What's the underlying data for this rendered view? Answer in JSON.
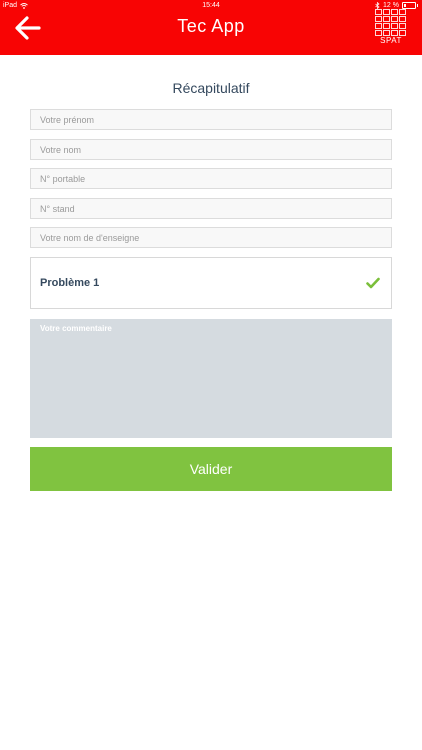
{
  "status_bar": {
    "device": "iPad",
    "time": "15:44",
    "battery": "12 %"
  },
  "header": {
    "title": "Tec App",
    "logo_text": "SPAT",
    "back_icon": "arrow-left-icon"
  },
  "colors": {
    "header_bg": "#f80404",
    "accent_green": "#80c340",
    "text_dark": "#35495e",
    "comment_bg": "#d5dbe0"
  },
  "form": {
    "section_title": "Récapitulatif",
    "first_name": {
      "placeholder": "Votre prénom",
      "value": ""
    },
    "last_name": {
      "placeholder": "Votre nom",
      "value": ""
    },
    "mobile": {
      "placeholder": "N° portable",
      "value": ""
    },
    "stand": {
      "placeholder": "N° stand",
      "value": ""
    },
    "brand": {
      "placeholder": "Votre nom de d'enseigne",
      "value": ""
    },
    "problem": {
      "label": "Problème 1",
      "icon": "check-icon"
    },
    "comment": {
      "placeholder": "Votre commentaire",
      "value": ""
    },
    "submit_label": "Valider"
  }
}
